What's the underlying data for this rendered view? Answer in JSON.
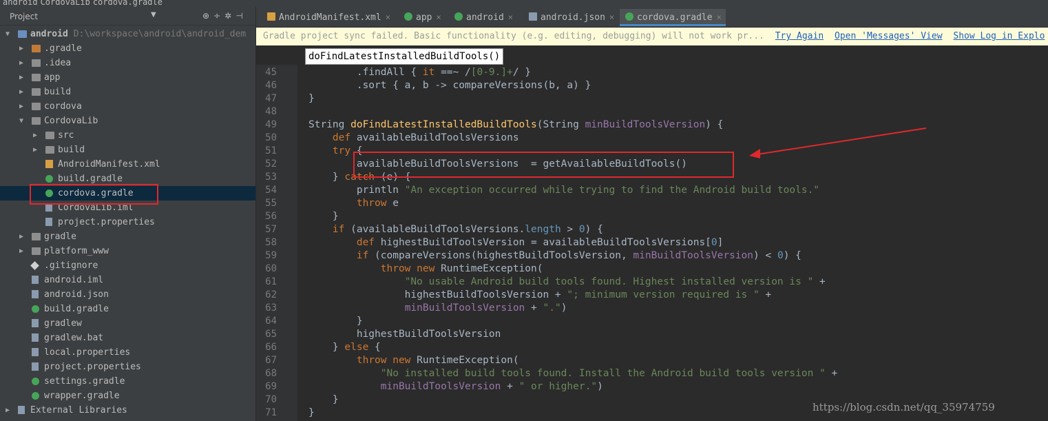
{
  "breadcrumb": [
    "android",
    "CordovaLib",
    "cordova.gradle"
  ],
  "project_panel": {
    "title": "Project",
    "items": [
      {
        "label": "android",
        "path": "D:\\workspace\\android\\android_dem",
        "indent": 0,
        "arrow": "down",
        "icon": "folder-blue"
      },
      {
        "label": ".gradle",
        "indent": 1,
        "arrow": "right",
        "icon": "folder-orange"
      },
      {
        "label": ".idea",
        "indent": 1,
        "arrow": "right",
        "icon": "folder"
      },
      {
        "label": "app",
        "indent": 1,
        "arrow": "right",
        "icon": "folder"
      },
      {
        "label": "build",
        "indent": 1,
        "arrow": "right",
        "icon": "folder"
      },
      {
        "label": "cordova",
        "indent": 1,
        "arrow": "right",
        "icon": "folder"
      },
      {
        "label": "CordovaLib",
        "indent": 1,
        "arrow": "down",
        "icon": "folder"
      },
      {
        "label": "src",
        "indent": 2,
        "arrow": "right",
        "icon": "folder"
      },
      {
        "label": "build",
        "indent": 2,
        "arrow": "right",
        "icon": "folder"
      },
      {
        "label": "AndroidManifest.xml",
        "indent": 2,
        "arrow": "",
        "icon": "xml"
      },
      {
        "label": "build.gradle",
        "indent": 2,
        "arrow": "",
        "icon": "gradle"
      },
      {
        "label": "cordova.gradle",
        "indent": 2,
        "arrow": "",
        "icon": "gradle",
        "selected": true
      },
      {
        "label": "CordovaLib.iml",
        "indent": 2,
        "arrow": "",
        "icon": "file"
      },
      {
        "label": "project.properties",
        "indent": 2,
        "arrow": "",
        "icon": "file"
      },
      {
        "label": "gradle",
        "indent": 1,
        "arrow": "right",
        "icon": "folder"
      },
      {
        "label": "platform_www",
        "indent": 1,
        "arrow": "right",
        "icon": "folder"
      },
      {
        "label": ".gitignore",
        "indent": 1,
        "arrow": "",
        "icon": "git"
      },
      {
        "label": "android.iml",
        "indent": 1,
        "arrow": "",
        "icon": "file"
      },
      {
        "label": "android.json",
        "indent": 1,
        "arrow": "",
        "icon": "file"
      },
      {
        "label": "build.gradle",
        "indent": 1,
        "arrow": "",
        "icon": "gradle"
      },
      {
        "label": "gradlew",
        "indent": 1,
        "arrow": "",
        "icon": "file"
      },
      {
        "label": "gradlew.bat",
        "indent": 1,
        "arrow": "",
        "icon": "file"
      },
      {
        "label": "local.properties",
        "indent": 1,
        "arrow": "",
        "icon": "file"
      },
      {
        "label": "project.properties",
        "indent": 1,
        "arrow": "",
        "icon": "file"
      },
      {
        "label": "settings.gradle",
        "indent": 1,
        "arrow": "",
        "icon": "gradle"
      },
      {
        "label": "wrapper.gradle",
        "indent": 1,
        "arrow": "",
        "icon": "gradle"
      },
      {
        "label": "External Libraries",
        "indent": 0,
        "arrow": "right",
        "icon": "library"
      }
    ]
  },
  "tabs": [
    {
      "label": "AndroidManifest.xml",
      "icon": "xml"
    },
    {
      "label": "app",
      "icon": "gradle"
    },
    {
      "label": "android",
      "icon": "gradle"
    },
    {
      "label": "android.json",
      "icon": "json"
    },
    {
      "label": "cordova.gradle",
      "icon": "gradle",
      "active": true
    }
  ],
  "banner": {
    "message": "Gradle project sync failed. Basic functionality (e.g. editing, debugging) will not work pr...",
    "links": [
      "Try Again",
      "Open 'Messages' View",
      "Show Log in Explo"
    ]
  },
  "tooltip": "doFindLatestInstalledBuildTools()",
  "line_numbers": [
    "45",
    "46",
    "47",
    "48",
    "49",
    "50",
    "51",
    "52",
    "53",
    "54",
    "55",
    "56",
    "57",
    "58",
    "59",
    "60",
    "61",
    "62",
    "63",
    "64",
    "65",
    "66",
    "67",
    "68",
    "69",
    "70",
    "71"
  ],
  "code_lines": [
    [
      {
        "t": "        .findAll { "
      },
      {
        "t": "it",
        "c": "kw"
      },
      {
        "t": " ==~ /"
      },
      {
        "t": "[0-9.]+",
        "c": "str"
      },
      {
        "t": "/ }"
      }
    ],
    [
      {
        "t": "        .sort { a, b -> compareVersions(b, a) }"
      }
    ],
    [
      {
        "t": "}"
      }
    ],
    [
      {
        "t": ""
      }
    ],
    [
      {
        "t": "String "
      },
      {
        "t": "doFindLatestInstalledBuildTools",
        "c": "fn"
      },
      {
        "t": "(String "
      },
      {
        "t": "minBuildToolsVersion",
        "c": "par"
      },
      {
        "t": ") {"
      }
    ],
    [
      {
        "t": "    "
      },
      {
        "t": "def",
        "c": "kw"
      },
      {
        "t": " availableBuildToolsVersions"
      }
    ],
    [
      {
        "t": "    "
      },
      {
        "t": "try",
        "c": "kw"
      },
      {
        "t": " {"
      }
    ],
    [
      {
        "t": "        availableBuildToolsVersions  = getAvailableBuildTools()"
      }
    ],
    [
      {
        "t": "    } "
      },
      {
        "t": "catch",
        "c": "kw"
      },
      {
        "t": " (e) {"
      }
    ],
    [
      {
        "t": "        println "
      },
      {
        "t": "\"An exception occurred while trying to find the Android build tools.\"",
        "c": "str"
      }
    ],
    [
      {
        "t": "        "
      },
      {
        "t": "throw",
        "c": "kw"
      },
      {
        "t": " e"
      }
    ],
    [
      {
        "t": "    }"
      }
    ],
    [
      {
        "t": "    "
      },
      {
        "t": "if",
        "c": "kw"
      },
      {
        "t": " (availableBuildToolsVersions."
      },
      {
        "t": "length",
        "c": "num"
      },
      {
        "t": " > "
      },
      {
        "t": "0",
        "c": "num"
      },
      {
        "t": ") {"
      }
    ],
    [
      {
        "t": "        "
      },
      {
        "t": "def",
        "c": "kw"
      },
      {
        "t": " highestBuildToolsVersion = availableBuildToolsVersions["
      },
      {
        "t": "0",
        "c": "num"
      },
      {
        "t": "]"
      }
    ],
    [
      {
        "t": "        "
      },
      {
        "t": "if",
        "c": "kw"
      },
      {
        "t": " (compareVersions(highestBuildToolsVersion, "
      },
      {
        "t": "minBuildToolsVersion",
        "c": "par"
      },
      {
        "t": ") < "
      },
      {
        "t": "0",
        "c": "num"
      },
      {
        "t": ") {"
      }
    ],
    [
      {
        "t": "            "
      },
      {
        "t": "throw new",
        "c": "kw"
      },
      {
        "t": " RuntimeException("
      }
    ],
    [
      {
        "t": "                "
      },
      {
        "t": "\"No usable Android build tools found. Highest installed version is \"",
        "c": "str"
      },
      {
        "t": " +"
      }
    ],
    [
      {
        "t": "                highestBuildToolsVersion + "
      },
      {
        "t": "\"; minimum version required is \"",
        "c": "str"
      },
      {
        "t": " +"
      }
    ],
    [
      {
        "t": "                "
      },
      {
        "t": "minBuildToolsVersion",
        "c": "par"
      },
      {
        "t": " + "
      },
      {
        "t": "\".\"",
        "c": "str"
      },
      {
        "t": ")"
      }
    ],
    [
      {
        "t": "        }"
      }
    ],
    [
      {
        "t": "        highestBuildToolsVersion"
      }
    ],
    [
      {
        "t": "    } "
      },
      {
        "t": "else",
        "c": "kw"
      },
      {
        "t": " {"
      }
    ],
    [
      {
        "t": "        "
      },
      {
        "t": "throw new",
        "c": "kw"
      },
      {
        "t": " RuntimeException("
      }
    ],
    [
      {
        "t": "            "
      },
      {
        "t": "\"No installed build tools found. Install the Android build tools version \"",
        "c": "str"
      },
      {
        "t": " +"
      }
    ],
    [
      {
        "t": "            "
      },
      {
        "t": "minBuildToolsVersion",
        "c": "par"
      },
      {
        "t": " + "
      },
      {
        "t": "\" or higher.\"",
        "c": "str"
      },
      {
        "t": ")"
      }
    ],
    [
      {
        "t": "    }"
      }
    ],
    [
      {
        "t": "}"
      }
    ]
  ],
  "watermark": "https://blog.csdn.net/qq_35974759",
  "colors": {
    "annotation_red": "#e0282d",
    "keyword": "#cc7832",
    "string": "#6a8759",
    "function": "#ffc66d",
    "param": "#9876aa",
    "number": "#6897bb"
  }
}
